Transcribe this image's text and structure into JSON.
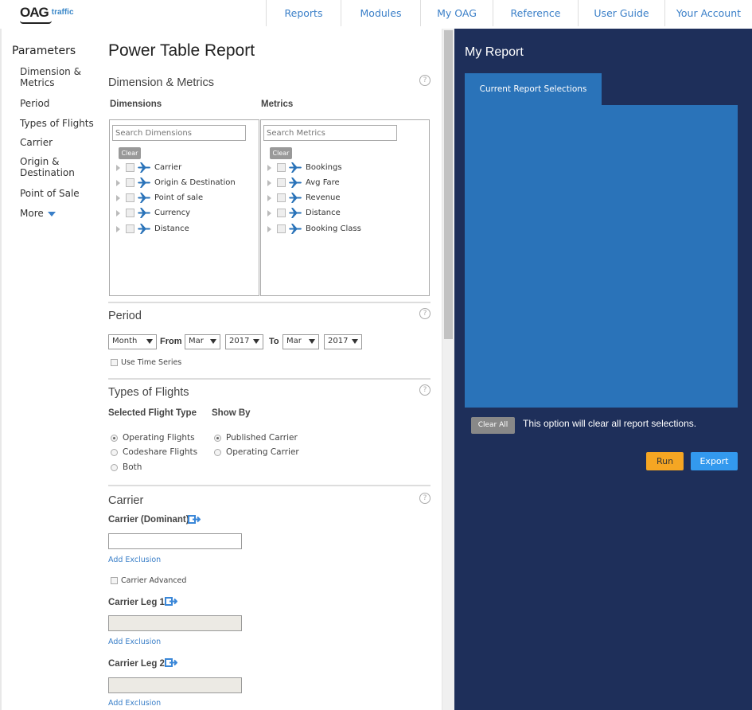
{
  "logo": {
    "brand": "OAG",
    "product": "traffic"
  },
  "nav": [
    "Reports",
    "Modules",
    "My OAG",
    "Reference",
    "User Guide",
    "Your Account"
  ],
  "sidebar": {
    "title": "Parameters",
    "items": [
      {
        "label": "Dimension & Metrics"
      },
      {
        "label": "Period"
      },
      {
        "label": "Types of Flights"
      },
      {
        "label": "Carrier"
      },
      {
        "label": "Origin & Destination"
      },
      {
        "label": "Point of Sale"
      },
      {
        "label": "More"
      }
    ]
  },
  "main": {
    "title": "Power Table Report",
    "help": "?",
    "dim_metrics": {
      "title": "Dimension & Metrics",
      "dimensions_label": "Dimensions",
      "metrics_label": "Metrics",
      "dim_search_placeholder": "Search Dimensions",
      "met_search_placeholder": "Search Metrics",
      "clear_label": "Clear",
      "dimensions": [
        "Carrier",
        "Origin & Destination",
        "Point of sale",
        "Currency",
        "Distance"
      ],
      "metrics": [
        "Bookings",
        "Avg Fare",
        "Revenue",
        "Distance",
        "Booking Class"
      ]
    },
    "period": {
      "title": "Period",
      "granularity": "Month",
      "from_label": "From",
      "from_month": "Mar",
      "from_year": "2017",
      "to_label": "To",
      "to_month": "Mar",
      "to_year": "2017",
      "time_series_label": "Use Time Series"
    },
    "flights": {
      "title": "Types of Flights",
      "selected_label": "Selected Flight Type",
      "show_by_label": "Show By",
      "types": [
        {
          "label": "Operating Flights",
          "checked": true
        },
        {
          "label": "Codeshare Flights",
          "checked": false
        },
        {
          "label": "Both",
          "checked": false
        }
      ],
      "show_by": [
        {
          "label": "Published Carrier",
          "checked": true
        },
        {
          "label": "Operating Carrier",
          "checked": false
        }
      ]
    },
    "carrier": {
      "title": "Carrier",
      "dominant_label": "Carrier (Dominant)",
      "add_exclusion": "Add Exclusion",
      "advanced_label": "Carrier Advanced",
      "leg1_label": "Carrier Leg 1",
      "leg2_label": "Carrier Leg 2"
    }
  },
  "report": {
    "title": "My Report",
    "tab_label": "Current Report Selections",
    "clear_all_label": "Clear All",
    "clear_all_message": "This option will clear all report selections.",
    "run_label": "Run",
    "export_label": "Export"
  },
  "colors": {
    "accent": "#3a7fc8",
    "right_panel_bg": "#1e2f5a",
    "selection_panel": "#2a73b9",
    "run_button": "#f5a623",
    "export_button": "#3399ee"
  }
}
